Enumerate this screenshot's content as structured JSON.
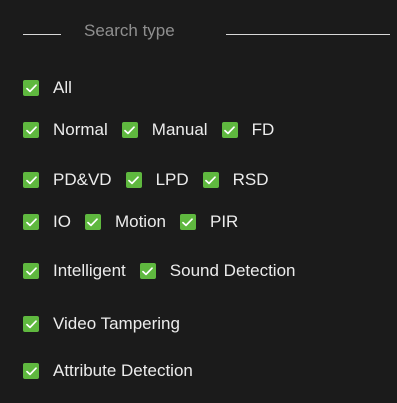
{
  "header": {
    "title": "Search type"
  },
  "colors": {
    "checkbox_checked": "#5fb83f",
    "background": "#1b1b1b",
    "text": "#ececec",
    "header_text": "#8f8f8f"
  },
  "rows": [
    [
      {
        "label": "All",
        "checked": true
      }
    ],
    [
      {
        "label": "Normal",
        "checked": true
      },
      {
        "label": "Manual",
        "checked": true
      },
      {
        "label": "FD",
        "checked": true
      }
    ],
    [
      {
        "label": "PD&VD",
        "checked": true
      },
      {
        "label": "LPD",
        "checked": true
      },
      {
        "label": "RSD",
        "checked": true
      }
    ],
    [
      {
        "label": "IO",
        "checked": true
      },
      {
        "label": "Motion",
        "checked": true
      },
      {
        "label": "PIR",
        "checked": true
      }
    ],
    [
      {
        "label": "Intelligent",
        "checked": true
      },
      {
        "label": "Sound Detection",
        "checked": true
      }
    ],
    [
      {
        "label": "Video Tampering",
        "checked": true
      }
    ],
    [
      {
        "label": "Attribute Detection",
        "checked": true
      }
    ]
  ]
}
